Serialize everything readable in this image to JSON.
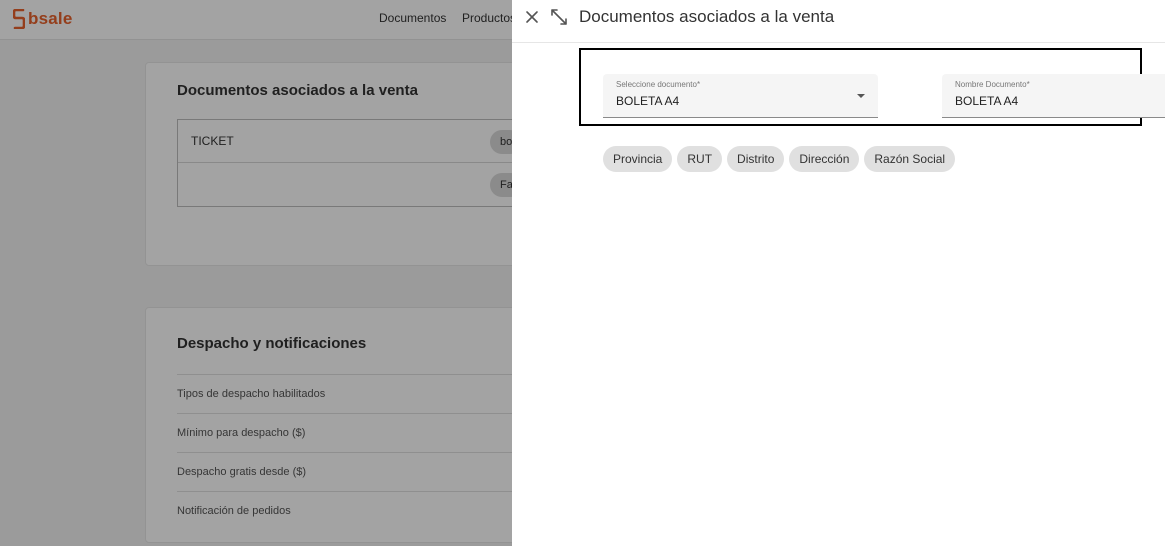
{
  "app": {
    "logo_text": "bsale",
    "brand_color": "#e8612c",
    "nav": {
      "documentos": "Documentos",
      "productos": "Productos"
    }
  },
  "docs_card": {
    "title": "Documentos asociados a la venta",
    "rows": [
      {
        "name": "TICKET",
        "chip": "bo"
      },
      {
        "name": "",
        "chip": "Fa"
      }
    ]
  },
  "despacho_card": {
    "title": "Despacho y notificaciones",
    "items": [
      "Tipos de despacho habilitados",
      "Mínimo para despacho ($)",
      "Despacho gratis desde ($)",
      "Notificación de pedidos"
    ]
  },
  "panel": {
    "title": "Documentos asociados a la venta",
    "close_icon": "close-icon",
    "expand_icon": "expand-icon",
    "select_field": {
      "label": "Seleccione documento*",
      "value": "BOLETA A4"
    },
    "name_field": {
      "label": "Nombre Documento*",
      "value": "BOLETA A4"
    },
    "chips": [
      "Provincia",
      "RUT",
      "Distrito",
      "Dirección",
      "Razón Social"
    ]
  }
}
